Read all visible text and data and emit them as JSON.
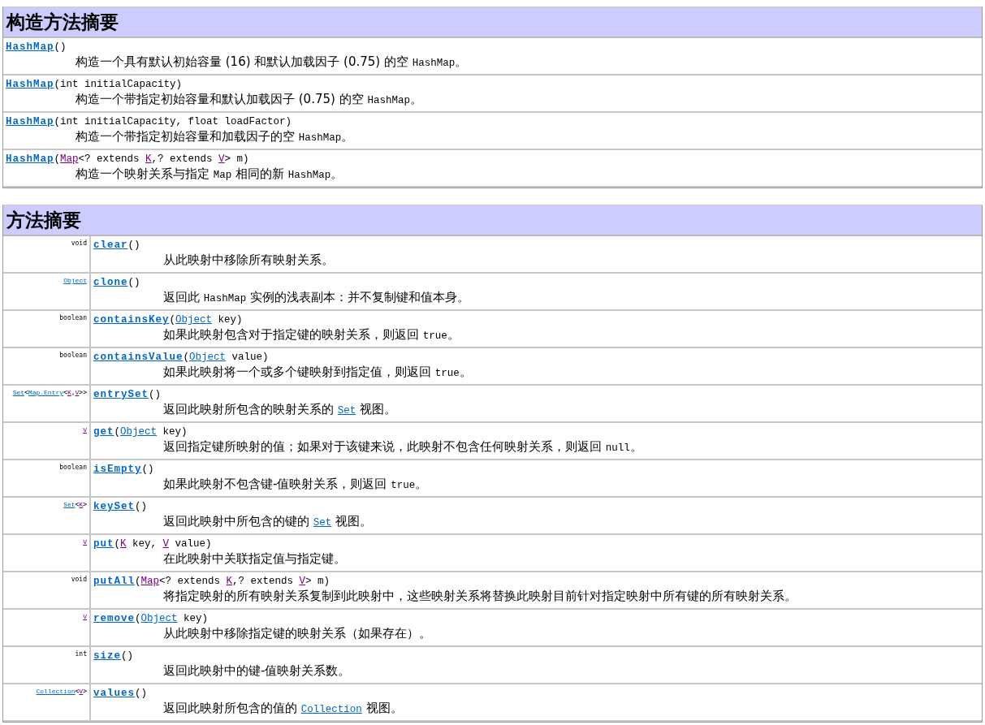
{
  "constructor_summary": {
    "title": "构造方法摘要",
    "rows": [
      {
        "signature": [
          {
            "text": "HashMap",
            "kind": "name",
            "visited": false
          },
          {
            "text": "()",
            "kind": "text"
          }
        ],
        "description": [
          {
            "text": "构造一个具有默认初始容量 (16) 和默认加载因子 (0.75) 的空 ",
            "kind": "text"
          },
          {
            "text": "HashMap",
            "kind": "code"
          },
          {
            "text": "。",
            "kind": "text"
          }
        ]
      },
      {
        "signature": [
          {
            "text": "HashMap",
            "kind": "name",
            "visited": false
          },
          {
            "text": "(int initialCapacity)",
            "kind": "text"
          }
        ],
        "description": [
          {
            "text": "构造一个带指定初始容量和默认加载因子 (0.75) 的空 ",
            "kind": "text"
          },
          {
            "text": "HashMap",
            "kind": "code"
          },
          {
            "text": "。",
            "kind": "text"
          }
        ]
      },
      {
        "signature": [
          {
            "text": "HashMap",
            "kind": "name",
            "visited": false
          },
          {
            "text": "(int initialCapacity, float loadFactor)",
            "kind": "text"
          }
        ],
        "description": [
          {
            "text": "构造一个带指定初始容量和加载因子的空 ",
            "kind": "text"
          },
          {
            "text": "HashMap",
            "kind": "code"
          },
          {
            "text": "。",
            "kind": "text"
          }
        ]
      },
      {
        "signature": [
          {
            "text": "HashMap",
            "kind": "name",
            "visited": false
          },
          {
            "text": "(",
            "kind": "text"
          },
          {
            "text": "Map",
            "kind": "link",
            "visited": true
          },
          {
            "text": "<? extends ",
            "kind": "text"
          },
          {
            "text": "K",
            "kind": "link",
            "visited": true
          },
          {
            "text": ",? extends ",
            "kind": "text"
          },
          {
            "text": "V",
            "kind": "link",
            "visited": true
          },
          {
            "text": "> m)",
            "kind": "text"
          }
        ],
        "description": [
          {
            "text": "构造一个映射关系与指定 ",
            "kind": "text"
          },
          {
            "text": "Map",
            "kind": "code"
          },
          {
            "text": " 相同的新 ",
            "kind": "text"
          },
          {
            "text": "HashMap",
            "kind": "code"
          },
          {
            "text": "。",
            "kind": "text"
          }
        ]
      }
    ]
  },
  "method_summary": {
    "title": "方法摘要",
    "rows": [
      {
        "type": [
          {
            "text": "void",
            "kind": "text"
          }
        ],
        "signature": [
          {
            "text": "clear",
            "kind": "name",
            "visited": false
          },
          {
            "text": "()",
            "kind": "text"
          }
        ],
        "description": [
          {
            "text": "从此映射中移除所有映射关系。",
            "kind": "text"
          }
        ]
      },
      {
        "type": [
          {
            "text": "Object",
            "kind": "link",
            "visited": false
          }
        ],
        "signature": [
          {
            "text": "clone",
            "kind": "name",
            "visited": false
          },
          {
            "text": "()",
            "kind": "text"
          }
        ],
        "description": [
          {
            "text": "返回此 ",
            "kind": "text"
          },
          {
            "text": "HashMap",
            "kind": "code"
          },
          {
            "text": " 实例的浅表副本：并不复制键和值本身。",
            "kind": "text"
          }
        ]
      },
      {
        "type": [
          {
            "text": "boolean",
            "kind": "text"
          }
        ],
        "signature": [
          {
            "text": "containsKey",
            "kind": "name",
            "visited": false
          },
          {
            "text": "(",
            "kind": "text"
          },
          {
            "text": "Object",
            "kind": "link",
            "visited": false
          },
          {
            "text": " key)",
            "kind": "text"
          }
        ],
        "description": [
          {
            "text": "如果此映射包含对于指定键的映射关系，则返回 ",
            "kind": "text"
          },
          {
            "text": "true",
            "kind": "code"
          },
          {
            "text": "。",
            "kind": "text"
          }
        ]
      },
      {
        "type": [
          {
            "text": "boolean",
            "kind": "text"
          }
        ],
        "signature": [
          {
            "text": "containsValue",
            "kind": "name",
            "visited": false
          },
          {
            "text": "(",
            "kind": "text"
          },
          {
            "text": "Object",
            "kind": "link",
            "visited": false
          },
          {
            "text": " value)",
            "kind": "text"
          }
        ],
        "description": [
          {
            "text": "如果此映射将一个或多个键映射到指定值，则返回 ",
            "kind": "text"
          },
          {
            "text": "true",
            "kind": "code"
          },
          {
            "text": "。",
            "kind": "text"
          }
        ]
      },
      {
        "type": [
          {
            "text": "Set",
            "kind": "link",
            "visited": false
          },
          {
            "text": "<",
            "kind": "text"
          },
          {
            "text": "Map.Entry",
            "kind": "link",
            "visited": false
          },
          {
            "text": "<",
            "kind": "text"
          },
          {
            "text": "K",
            "kind": "link",
            "visited": true
          },
          {
            "text": ",",
            "kind": "text"
          },
          {
            "text": "V",
            "kind": "link",
            "visited": true
          },
          {
            "text": ">>",
            "kind": "text"
          }
        ],
        "signature": [
          {
            "text": "entrySet",
            "kind": "name",
            "visited": false
          },
          {
            "text": "()",
            "kind": "text"
          }
        ],
        "description": [
          {
            "text": "返回此映射所包含的映射关系的 ",
            "kind": "text"
          },
          {
            "text": "Set",
            "kind": "link",
            "visited": false
          },
          {
            "text": " 视图。",
            "kind": "text"
          }
        ]
      },
      {
        "type": [
          {
            "text": "V",
            "kind": "link",
            "visited": true
          }
        ],
        "signature": [
          {
            "text": "get",
            "kind": "name",
            "visited": false
          },
          {
            "text": "(",
            "kind": "text"
          },
          {
            "text": "Object",
            "kind": "link",
            "visited": false
          },
          {
            "text": " key)",
            "kind": "text"
          }
        ],
        "description": [
          {
            "text": "返回指定键所映射的值；如果对于该键来说，此映射不包含任何映射关系，则返回 ",
            "kind": "text"
          },
          {
            "text": "null",
            "kind": "code"
          },
          {
            "text": "。",
            "kind": "text"
          }
        ]
      },
      {
        "type": [
          {
            "text": "boolean",
            "kind": "text"
          }
        ],
        "signature": [
          {
            "text": "isEmpty",
            "kind": "name",
            "visited": false
          },
          {
            "text": "()",
            "kind": "text"
          }
        ],
        "description": [
          {
            "text": "如果此映射不包含键-值映射关系，则返回 ",
            "kind": "text"
          },
          {
            "text": "true",
            "kind": "code"
          },
          {
            "text": "。",
            "kind": "text"
          }
        ]
      },
      {
        "type": [
          {
            "text": "Set",
            "kind": "link",
            "visited": false
          },
          {
            "text": "<",
            "kind": "text"
          },
          {
            "text": "K",
            "kind": "link",
            "visited": true
          },
          {
            "text": ">",
            "kind": "text"
          }
        ],
        "signature": [
          {
            "text": "keySet",
            "kind": "name",
            "visited": false
          },
          {
            "text": "()",
            "kind": "text"
          }
        ],
        "description": [
          {
            "text": "返回此映射中所包含的键的 ",
            "kind": "text"
          },
          {
            "text": "Set",
            "kind": "link",
            "visited": false
          },
          {
            "text": " 视图。",
            "kind": "text"
          }
        ]
      },
      {
        "type": [
          {
            "text": "V",
            "kind": "link",
            "visited": true
          }
        ],
        "signature": [
          {
            "text": "put",
            "kind": "name",
            "visited": false
          },
          {
            "text": "(",
            "kind": "text"
          },
          {
            "text": "K",
            "kind": "link",
            "visited": true
          },
          {
            "text": " key, ",
            "kind": "text"
          },
          {
            "text": "V",
            "kind": "link",
            "visited": true
          },
          {
            "text": " value)",
            "kind": "text"
          }
        ],
        "description": [
          {
            "text": "在此映射中关联指定值与指定键。",
            "kind": "text"
          }
        ]
      },
      {
        "type": [
          {
            "text": "void",
            "kind": "text"
          }
        ],
        "signature": [
          {
            "text": "putAll",
            "kind": "name",
            "visited": false
          },
          {
            "text": "(",
            "kind": "text"
          },
          {
            "text": "Map",
            "kind": "link",
            "visited": true
          },
          {
            "text": "<? extends ",
            "kind": "text"
          },
          {
            "text": "K",
            "kind": "link",
            "visited": true
          },
          {
            "text": ",? extends ",
            "kind": "text"
          },
          {
            "text": "V",
            "kind": "link",
            "visited": true
          },
          {
            "text": "> m)",
            "kind": "text"
          }
        ],
        "description": [
          {
            "text": "将指定映射的所有映射关系复制到此映射中，这些映射关系将替换此映射目前针对指定映射中所有键的所有映射关系。",
            "kind": "text"
          }
        ]
      },
      {
        "type": [
          {
            "text": "V",
            "kind": "link",
            "visited": true
          }
        ],
        "signature": [
          {
            "text": "remove",
            "kind": "name",
            "visited": false
          },
          {
            "text": "(",
            "kind": "text"
          },
          {
            "text": "Object",
            "kind": "link",
            "visited": false
          },
          {
            "text": " key)",
            "kind": "text"
          }
        ],
        "description": [
          {
            "text": "从此映射中移除指定键的映射关系（如果存在）。",
            "kind": "text"
          }
        ]
      },
      {
        "type": [
          {
            "text": "int",
            "kind": "text"
          }
        ],
        "signature": [
          {
            "text": "size",
            "kind": "name",
            "visited": false
          },
          {
            "text": "()",
            "kind": "text"
          }
        ],
        "description": [
          {
            "text": "返回此映射中的键-值映射关系数。",
            "kind": "text"
          }
        ]
      },
      {
        "type": [
          {
            "text": "Collection",
            "kind": "link",
            "visited": false
          },
          {
            "text": "<",
            "kind": "text"
          },
          {
            "text": "V",
            "kind": "link",
            "visited": true
          },
          {
            "text": ">",
            "kind": "text"
          }
        ],
        "signature": [
          {
            "text": "values",
            "kind": "name",
            "visited": false
          },
          {
            "text": "()",
            "kind": "text"
          }
        ],
        "description": [
          {
            "text": "返回此映射所包含的值的 ",
            "kind": "text"
          },
          {
            "text": "Collection",
            "kind": "link",
            "visited": false
          },
          {
            "text": " 视图。",
            "kind": "text"
          }
        ]
      }
    ]
  }
}
